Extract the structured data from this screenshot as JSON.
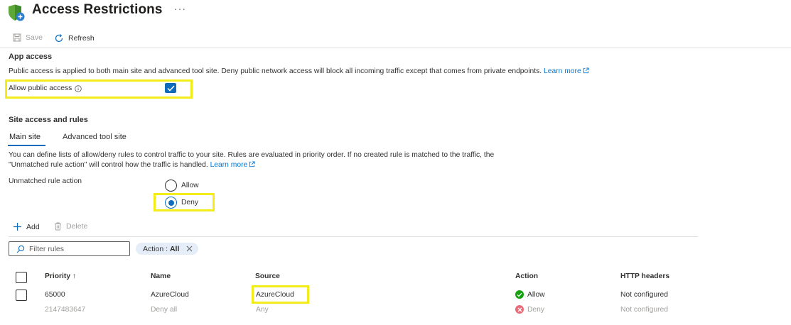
{
  "header": {
    "title": "Access Restrictions",
    "more": "···"
  },
  "toolbar": {
    "save_label": "Save",
    "refresh_label": "Refresh"
  },
  "app_access": {
    "heading": "App access",
    "description": "Public access is applied to both main site and advanced tool site. Deny public network access will block all incoming traffic except that comes from private endpoints.",
    "learn_more": "Learn more",
    "allow_public_label": "Allow public access",
    "allow_public_checked": true
  },
  "site_access": {
    "heading": "Site access and rules",
    "tabs": [
      {
        "label": "Main site",
        "selected": true
      },
      {
        "label": "Advanced tool site",
        "selected": false
      }
    ],
    "description": "You can define lists of allow/deny rules to control traffic to your site. Rules are evaluated in priority order. If no created rule is matched to the traffic, the \"Unmatched rule action\" will control how the traffic is handled.",
    "learn_more": "Learn more",
    "unmatched_label": "Unmatched rule action",
    "options": [
      {
        "label": "Allow",
        "checked": false
      },
      {
        "label": "Deny",
        "checked": true
      }
    ]
  },
  "rules_toolbar": {
    "add_label": "Add",
    "delete_label": "Delete"
  },
  "filter": {
    "placeholder": "Filter rules",
    "pill_key": "Action : ",
    "pill_value": "All"
  },
  "table": {
    "columns": [
      "Priority ↑",
      "Name",
      "Source",
      "Action",
      "HTTP headers"
    ],
    "rows": [
      {
        "priority": "65000",
        "name": "AzureCloud",
        "source": "AzureCloud",
        "action": "Allow",
        "headers": "Not configured"
      },
      {
        "priority": "2147483647",
        "name": "Deny all",
        "source": "Any",
        "action": "Deny",
        "headers": "Not configured"
      }
    ]
  },
  "colors": {
    "accent": "#0f6cbd",
    "highlight": "#f2ec1a",
    "allow_green": "#13a10e",
    "deny_red": "#e86b78"
  }
}
